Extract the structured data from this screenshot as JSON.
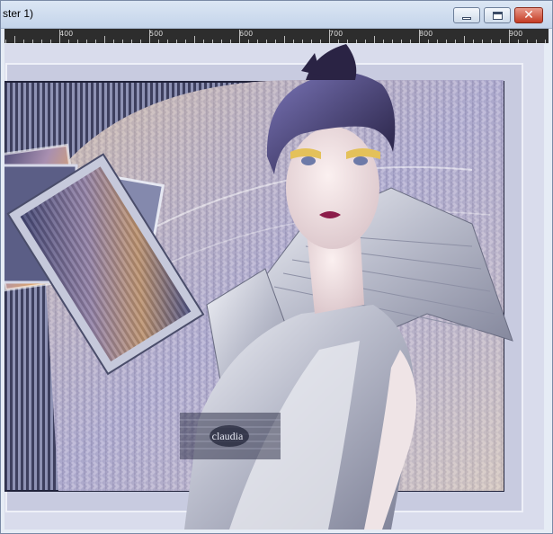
{
  "window": {
    "title": "ster 1)",
    "buttons": {
      "minimize_icon": "minimize-icon",
      "maximize_icon": "maximize-icon",
      "close_icon": "close-icon",
      "close_glyph": "✕"
    },
    "accent": "#c43b24"
  },
  "ruler": {
    "labels": [
      "400",
      "500",
      "600",
      "700",
      "800",
      "900"
    ]
  },
  "artwork": {
    "watermark": "claudia",
    "palette": {
      "frame": "#c8cbe0",
      "purple": "#6f67a0",
      "silver": "#c9ccd8",
      "gold": "#e4c15a",
      "lips": "#8c1c4a"
    }
  }
}
